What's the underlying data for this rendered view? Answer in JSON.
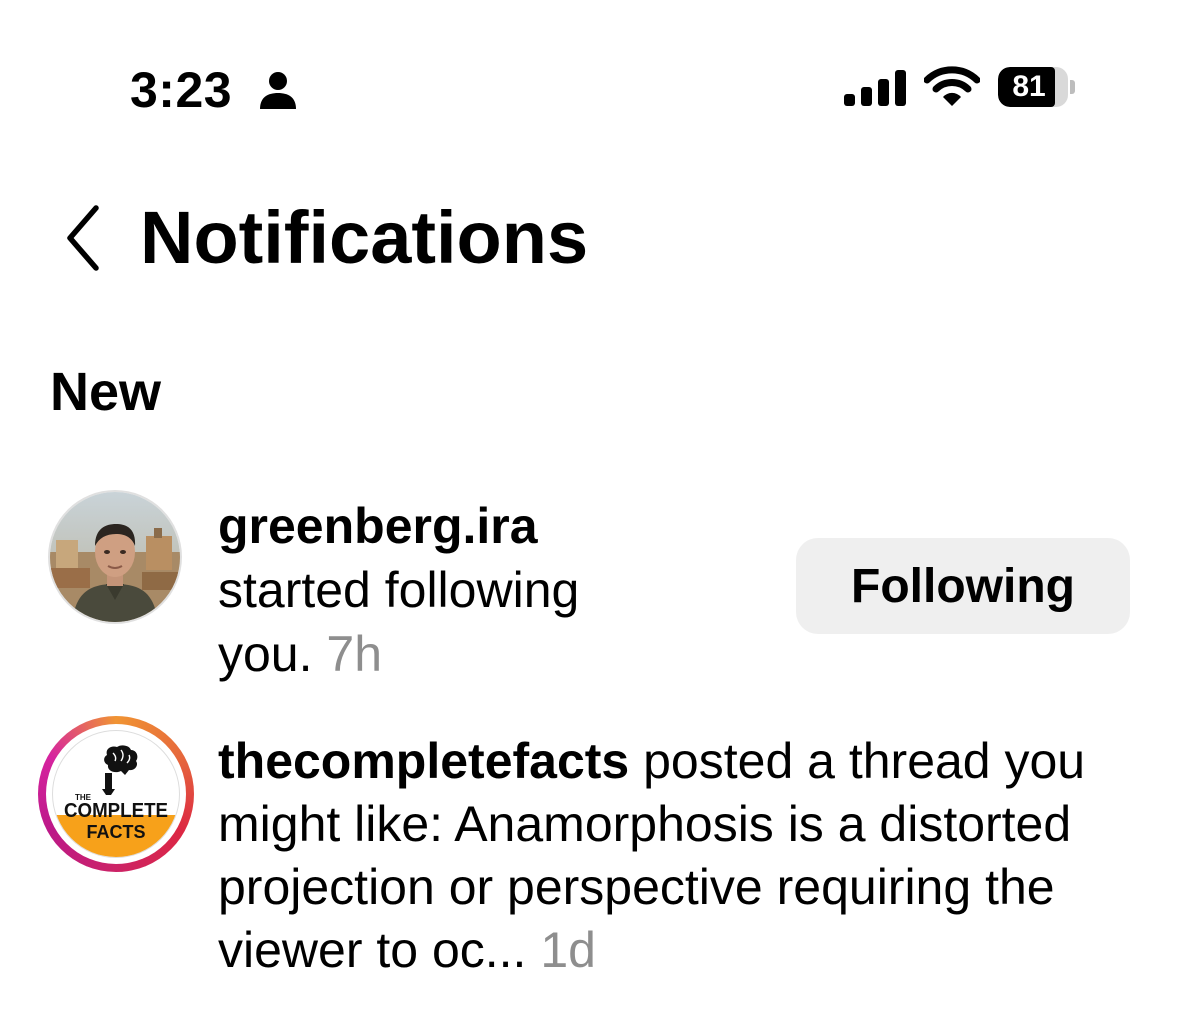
{
  "status_bar": {
    "time": "3:23",
    "battery_level": "81",
    "battery_fraction": 0.81,
    "icons": [
      "person-icon",
      "signal-icon",
      "wifi-icon",
      "battery-icon"
    ]
  },
  "header": {
    "title": "Notifications",
    "back_icon": "chevron-left-icon"
  },
  "section": {
    "label": "New"
  },
  "notifications": [
    {
      "username": "greenberg.ira",
      "message": " started following you.",
      "timestamp": "7h",
      "action_label": "Following"
    },
    {
      "username": "thecompletefacts",
      "message": " posted a thread you might like: Anamorphosis is a distorted projection or perspective requiring the viewer to oc...",
      "timestamp": "1d",
      "avatar_logo": {
        "line1": "THE",
        "line2": "COMPLETE",
        "line3": "FACTS"
      }
    }
  ],
  "colors": {
    "timestamp_gray": "#8e8e8e",
    "button_bg": "#efefef",
    "logo_orange": "#f7a11a"
  }
}
